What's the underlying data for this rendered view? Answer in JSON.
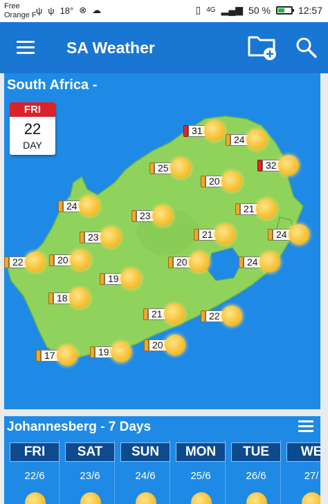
{
  "status_bar": {
    "carrier_line1": "Free",
    "carrier_line2": "Orange F",
    "temperature": "18°",
    "battery": "50 %",
    "battery_level": 0.5,
    "time": "12:57"
  },
  "app_bar": {
    "title": "SA Weather",
    "accent_color": "#1976d2"
  },
  "map": {
    "title": "South Africa -",
    "calendar": {
      "day": "FRI",
      "date": "22",
      "unit": "DAY"
    },
    "cities": [
      {
        "temp": "31",
        "hot": true
      },
      {
        "temp": "24",
        "hot": false
      },
      {
        "temp": "25",
        "hot": false
      },
      {
        "temp": "32",
        "hot": true
      },
      {
        "temp": "20",
        "hot": false
      },
      {
        "temp": "24",
        "hot": false
      },
      {
        "temp": "21",
        "hot": false
      },
      {
        "temp": "23",
        "hot": false
      },
      {
        "temp": "23",
        "hot": false
      },
      {
        "temp": "21",
        "hot": false
      },
      {
        "temp": "24",
        "hot": false
      },
      {
        "temp": "22",
        "hot": false
      },
      {
        "temp": "20",
        "hot": false
      },
      {
        "temp": "20",
        "hot": false
      },
      {
        "temp": "24",
        "hot": false
      },
      {
        "temp": "19",
        "hot": false
      },
      {
        "temp": "18",
        "hot": false
      },
      {
        "temp": "21",
        "hot": false
      },
      {
        "temp": "22",
        "hot": false
      },
      {
        "temp": "20",
        "hot": false
      },
      {
        "temp": "17",
        "hot": false
      },
      {
        "temp": "19",
        "hot": false
      }
    ]
  },
  "forecast": {
    "title": "Johannesberg - 7 Days",
    "days": [
      {
        "name": "FRI",
        "date": "22/6"
      },
      {
        "name": "SAT",
        "date": "23/6"
      },
      {
        "name": "SUN",
        "date": "24/6"
      },
      {
        "name": "MON",
        "date": "25/6"
      },
      {
        "name": "TUE",
        "date": "26/6"
      },
      {
        "name": "WE",
        "date": "27/"
      }
    ]
  }
}
